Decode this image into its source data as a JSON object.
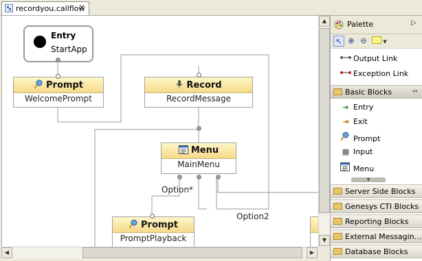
{
  "editor_tab": {
    "title": "recordyou.callflow",
    "close": "✕"
  },
  "canvas": {
    "entry": {
      "title": "Entry",
      "subtitle": "StartApp"
    },
    "nodes": {
      "prompt1": {
        "title": "Prompt",
        "name": "WelcomePrompt"
      },
      "record": {
        "title": "Record",
        "name": "RecordMessage"
      },
      "menu": {
        "title": "Menu",
        "name": "MainMenu"
      },
      "prompt2": {
        "title": "Prompt",
        "name": "PromptPlayback"
      }
    },
    "edge_labels": {
      "option_star": "Option*",
      "option2": "Option2"
    }
  },
  "palette": {
    "title": "Palette",
    "links": [
      {
        "label": "Output Link",
        "icon": "output-link-icon"
      },
      {
        "label": "Exception Link",
        "icon": "exception-link-icon"
      }
    ],
    "open_drawer": "Basic Blocks",
    "basic_blocks": [
      {
        "label": "Entry",
        "icon": "entry-icon"
      },
      {
        "label": "Exit",
        "icon": "exit-icon"
      },
      {
        "label": "Prompt",
        "icon": "prompt-icon"
      },
      {
        "label": "Input",
        "icon": "input-icon"
      },
      {
        "label": "Menu",
        "icon": "menu-icon"
      }
    ],
    "drawers": [
      "Server Side Blocks",
      "Genesys CTI Blocks",
      "Reporting Blocks",
      "External Messagin...",
      "Database Blocks"
    ]
  }
}
